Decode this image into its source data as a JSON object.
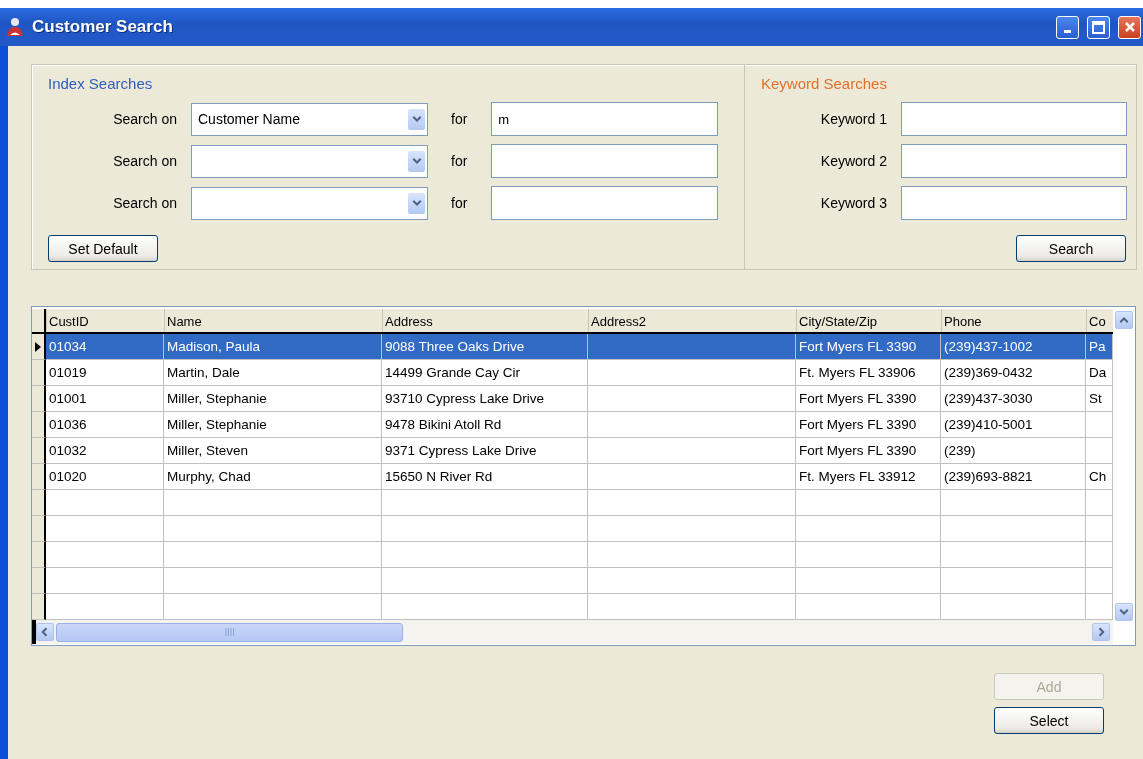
{
  "window": {
    "title": "Customer Search"
  },
  "index_searches": {
    "title": "Index Searches",
    "rows": [
      {
        "label": "Search on",
        "field": "Customer Name",
        "for_label": "for",
        "value": "m"
      },
      {
        "label": "Search on",
        "for_label": "for"
      },
      {
        "label": "Search on",
        "for_label": "for"
      }
    ],
    "set_default_button": "Set Default"
  },
  "keyword_searches": {
    "title": "Keyword Searches",
    "rows": [
      {
        "label": "Keyword 1"
      },
      {
        "label": "Keyword 2"
      },
      {
        "label": "Keyword 3"
      }
    ],
    "search_button": "Search"
  },
  "table": {
    "columns": [
      "CustID",
      "Name",
      "Address",
      "Address2",
      "City/State/Zip",
      "Phone",
      "Co"
    ],
    "rows": [
      {
        "selected": true,
        "cells": [
          "01034",
          "Madison, Paula",
          "9088 Three Oaks Drive",
          null,
          "Fort Myers FL 3390",
          "(239)437-1002",
          "Pa"
        ]
      },
      {
        "selected": false,
        "cells": [
          "01019",
          "Martin, Dale",
          "14499 Grande Cay Cir",
          null,
          "Ft. Myers FL 33906",
          "(239)369-0432",
          "Da"
        ]
      },
      {
        "selected": false,
        "cells": [
          "01001",
          "Miller, Stephanie",
          "93710 Cypress Lake Drive",
          null,
          "Fort Myers FL 3390",
          "(239)437-3030",
          "St"
        ]
      },
      {
        "selected": false,
        "cells": [
          "01036",
          "Miller, Stephanie",
          "9478 Bikini Atoll Rd",
          null,
          "Fort Myers FL 3390",
          "(239)410-5001",
          null
        ]
      },
      {
        "selected": false,
        "cells": [
          "01032",
          "Miller, Steven",
          "9371 Cypress Lake Drive",
          null,
          "Fort Myers FL 3390",
          "(239)",
          null
        ]
      },
      {
        "selected": false,
        "cells": [
          "01020",
          "Murphy, Chad",
          "15650 N River Rd",
          null,
          "Ft. Myers FL 33912",
          "(239)693-8821",
          "Ch"
        ]
      }
    ]
  },
  "buttons": [
    {
      "label": "Add",
      "disabled": true
    },
    {
      "label": "Select",
      "disabled": false
    }
  ]
}
